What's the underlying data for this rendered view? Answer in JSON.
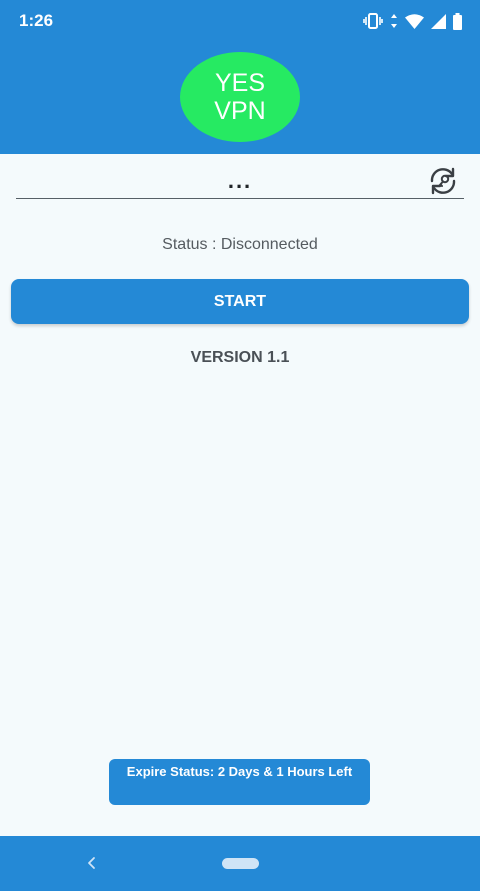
{
  "status_bar": {
    "time": "1:26",
    "icons": [
      "vibrate-icon",
      "data-arrows-icon",
      "wifi-icon",
      "signal-icon",
      "battery-icon"
    ]
  },
  "header": {
    "logo_line1": "YES",
    "logo_line2": "VPN"
  },
  "server": {
    "value": "...",
    "refresh_icon": "refresh-icon"
  },
  "status": {
    "text": "Status : Disconnected"
  },
  "start_button": {
    "label": "START"
  },
  "version": {
    "text": "VERSION 1.1"
  },
  "expire": {
    "text": "Expire Status: 2 Days & 1 Hours Left"
  },
  "nav": {
    "back_icon": "back-chevron-icon",
    "home_icon": "home-pill-icon"
  },
  "colors": {
    "primary": "#2489d6",
    "logo_green": "#26ea62",
    "background": "#f4fafc"
  }
}
